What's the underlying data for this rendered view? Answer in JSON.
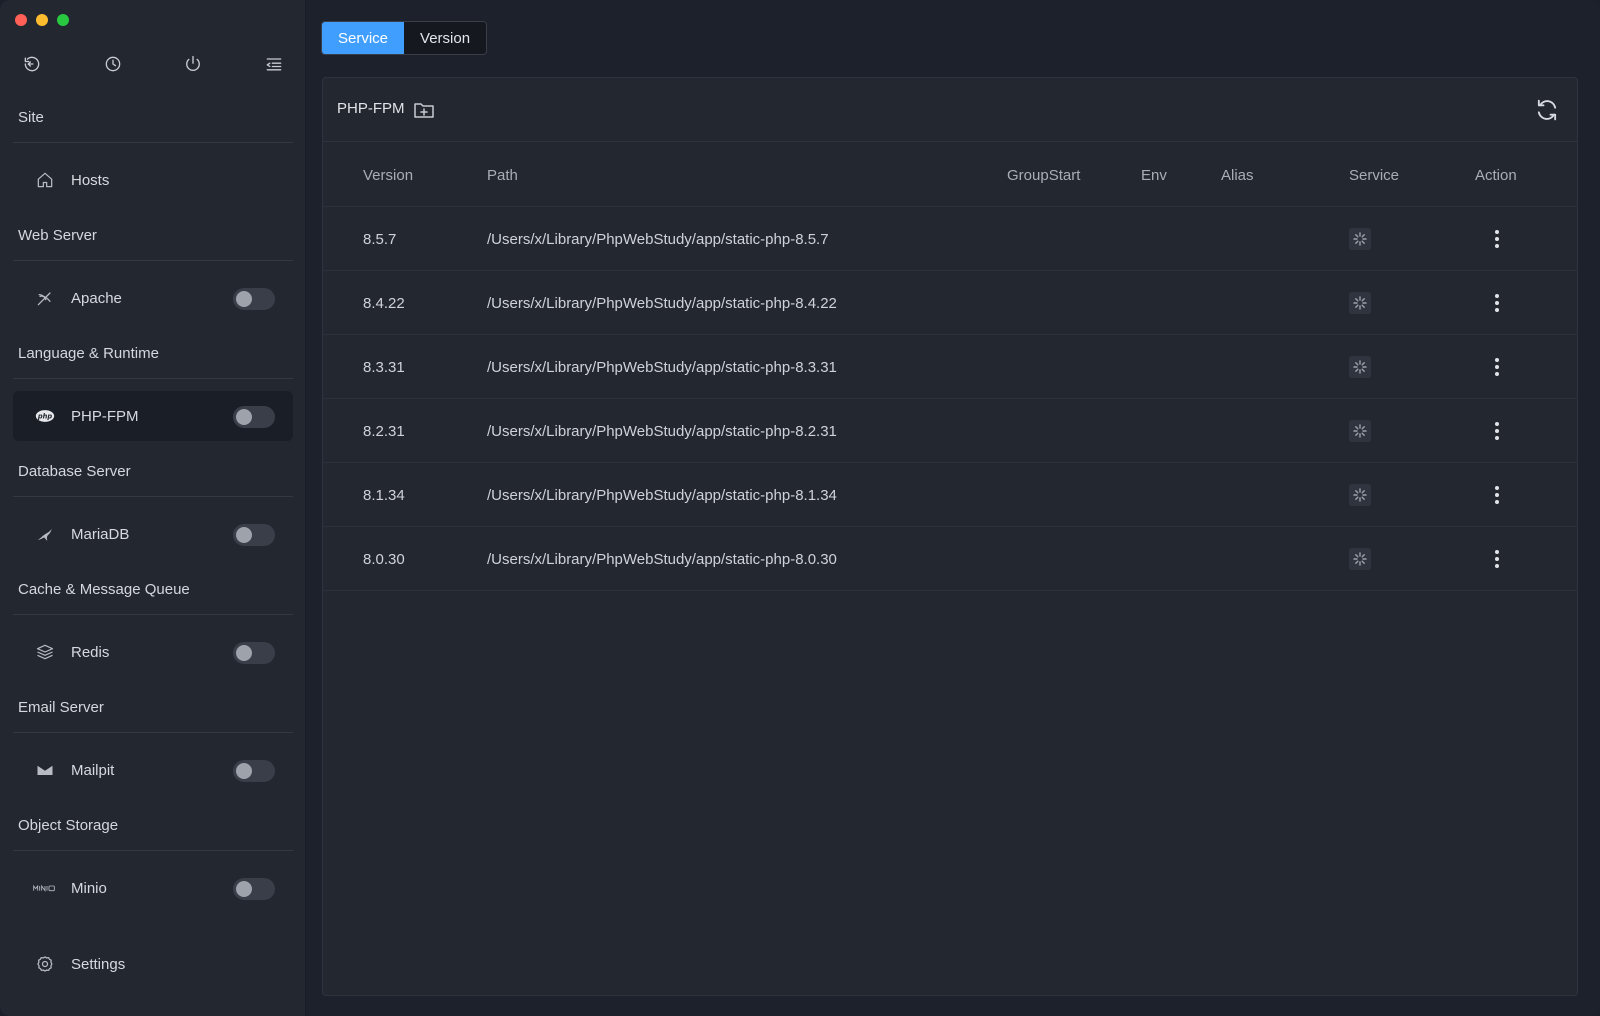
{
  "sidebar": {
    "top_icons": [
      "back-arrow-icon",
      "clock-icon",
      "power-icon",
      "menu-collapse-icon"
    ],
    "groups": [
      {
        "title": "Site",
        "items": [
          {
            "label": "Hosts",
            "icon": "home-icon",
            "toggle": false
          }
        ]
      },
      {
        "title": "Web Server",
        "items": [
          {
            "label": "Apache",
            "icon": "feather-icon",
            "toggle": true
          }
        ]
      },
      {
        "title": "Language & Runtime",
        "items": [
          {
            "label": "PHP-FPM",
            "icon": "php-icon",
            "toggle": true
          }
        ]
      },
      {
        "title": "Database Server",
        "items": [
          {
            "label": "MariaDB",
            "icon": "seal-icon",
            "toggle": true
          }
        ]
      },
      {
        "title": "Cache & Message Queue",
        "items": [
          {
            "label": "Redis",
            "icon": "stack-icon",
            "toggle": true
          }
        ]
      },
      {
        "title": "Email Server",
        "items": [
          {
            "label": "Mailpit",
            "icon": "mail-icon",
            "toggle": true
          }
        ]
      },
      {
        "title": "Object Storage",
        "items": [
          {
            "label": "Minio",
            "icon": "minio-icon",
            "toggle": true
          }
        ]
      }
    ],
    "settings_label": "Settings"
  },
  "tabs": [
    {
      "label": "Service",
      "active": true
    },
    {
      "label": "Version",
      "active": false
    }
  ],
  "panel": {
    "title": "PHP-FPM",
    "columns": {
      "version": "Version",
      "path": "Path",
      "group": "GroupStart",
      "env": "Env",
      "alias": "Alias",
      "service": "Service",
      "action": "Action"
    },
    "rows": [
      {
        "version": "8.5.7",
        "path": "/Users/x/Library/PhpWebStudy/app/static-php-8.5.7"
      },
      {
        "version": "8.4.22",
        "path": "/Users/x/Library/PhpWebStudy/app/static-php-8.4.22"
      },
      {
        "version": "8.3.31",
        "path": "/Users/x/Library/PhpWebStudy/app/static-php-8.3.31"
      },
      {
        "version": "8.2.31",
        "path": "/Users/x/Library/PhpWebStudy/app/static-php-8.2.31"
      },
      {
        "version": "8.1.34",
        "path": "/Users/x/Library/PhpWebStudy/app/static-php-8.1.34"
      },
      {
        "version": "8.0.30",
        "path": "/Users/x/Library/PhpWebStudy/app/static-php-8.0.30"
      }
    ]
  },
  "colors": {
    "accent": "#409eff",
    "background": "#1d212b",
    "sidebar": "#232730"
  }
}
